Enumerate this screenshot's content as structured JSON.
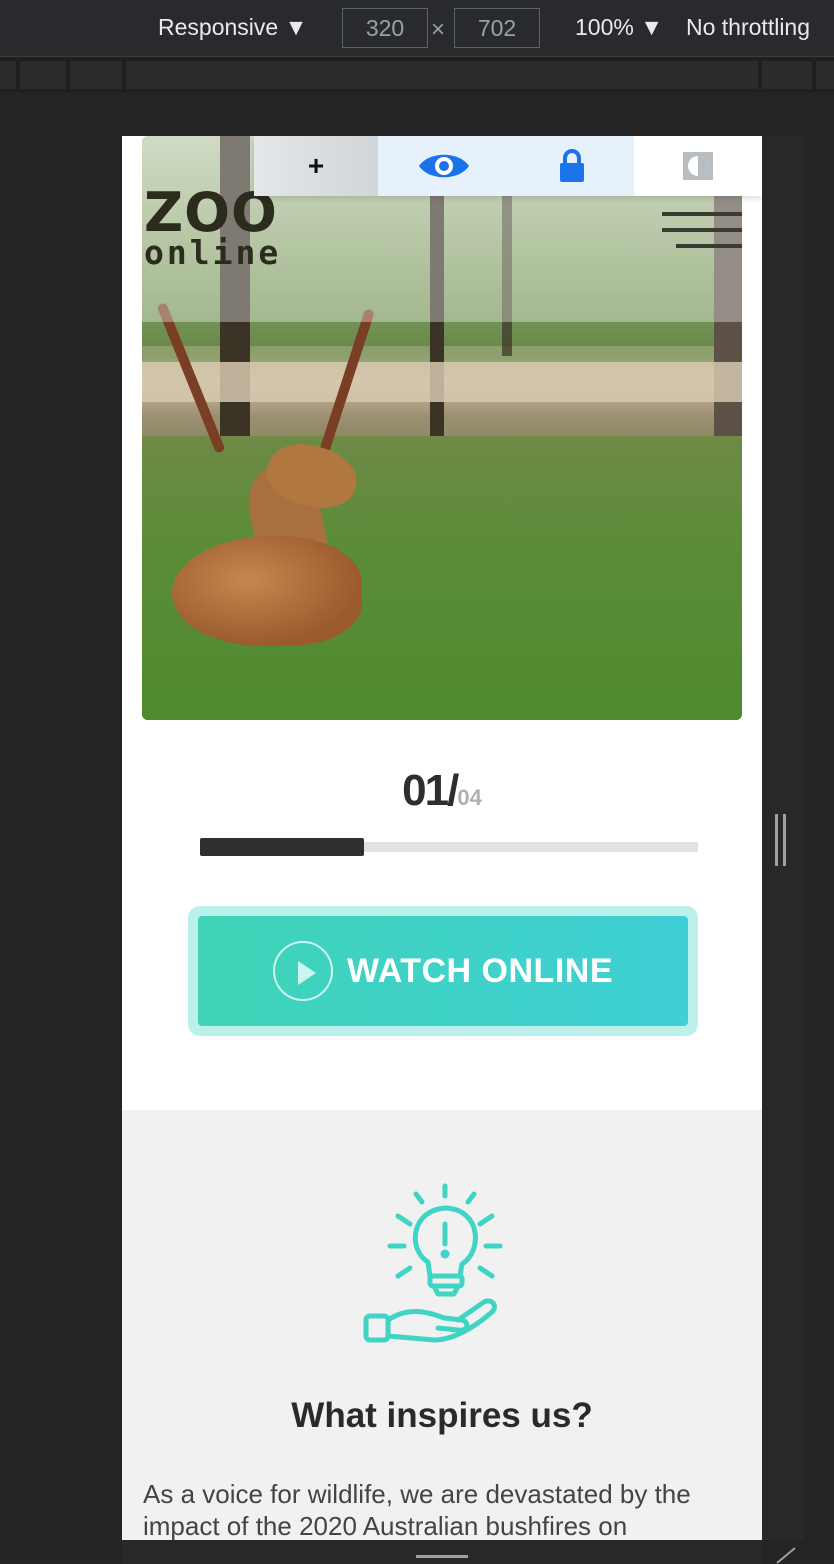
{
  "devtools": {
    "device_label": "Responsive ▼",
    "width_value": "320",
    "height_value": "702",
    "times_symbol": "×",
    "zoom_label": "100% ▼",
    "throttle_label": "No throttling"
  },
  "accessibility_bar": {
    "buttons": [
      {
        "name": "zoom-in",
        "glyph": "+"
      },
      {
        "name": "eye",
        "glyph": ""
      },
      {
        "name": "lock",
        "glyph": ""
      },
      {
        "name": "contrast",
        "glyph": ""
      }
    ]
  },
  "header": {
    "logo_line1": "ZOO",
    "logo_line2": "online"
  },
  "slider": {
    "current": "01/",
    "total": "04",
    "progress": 0.33
  },
  "cta": {
    "label": "WATCH ONLINE"
  },
  "inspire": {
    "title": "What inspires us?",
    "body": "As a voice for wildlife, we are devastated by the impact of the 2020 Australian bushfires on"
  },
  "colors": {
    "accent": "#3fd4c4",
    "icon_blue": "#1a73e8",
    "dark": "#2e2e2e"
  }
}
